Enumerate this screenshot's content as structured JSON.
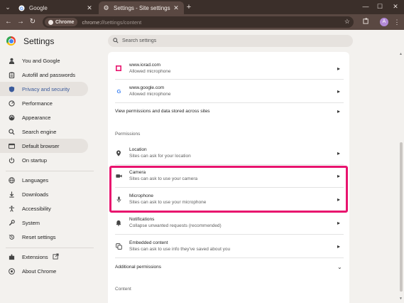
{
  "browser": {
    "tabs": [
      {
        "title": "Google",
        "active": false
      },
      {
        "title": "Settings - Site settings",
        "active": true
      }
    ],
    "new_tab_label": "+",
    "chip_label": "Chrome",
    "url_host": "chrome://",
    "url_path": "settings/content",
    "avatar_letter": "A"
  },
  "header": {
    "title": "Settings",
    "search_placeholder": "Search settings"
  },
  "sidebar": {
    "items": [
      {
        "label": "You and Google",
        "icon": "person-icon"
      },
      {
        "label": "Autofill and passwords",
        "icon": "clipboard-icon"
      },
      {
        "label": "Privacy and security",
        "icon": "shield-icon"
      },
      {
        "label": "Performance",
        "icon": "speedometer-icon"
      },
      {
        "label": "Appearance",
        "icon": "palette-icon"
      },
      {
        "label": "Search engine",
        "icon": "search-icon"
      },
      {
        "label": "Default browser",
        "icon": "browser-icon"
      },
      {
        "label": "On startup",
        "icon": "power-icon"
      },
      {
        "label": "Languages",
        "icon": "globe-icon"
      },
      {
        "label": "Downloads",
        "icon": "download-icon"
      },
      {
        "label": "Accessibility",
        "icon": "accessibility-icon"
      },
      {
        "label": "System",
        "icon": "wrench-icon"
      },
      {
        "label": "Reset settings",
        "icon": "reset-icon"
      },
      {
        "label": "Extensions",
        "icon": "puzzle-icon"
      },
      {
        "label": "About Chrome",
        "icon": "chrome-icon"
      }
    ]
  },
  "main": {
    "sites": [
      {
        "title": "www.iorad.com",
        "subtitle": "Allowed microphone"
      },
      {
        "title": "www.google.com",
        "subtitle": "Allowed microphone"
      }
    ],
    "view_all": "View permissions and data stored across sites",
    "permissions_heading": "Permissions",
    "permissions": [
      {
        "title": "Location",
        "subtitle": "Sites can ask for your location"
      },
      {
        "title": "Camera",
        "subtitle": "Sites can ask to use your camera"
      },
      {
        "title": "Microphone",
        "subtitle": "Sites can ask to use your microphone"
      },
      {
        "title": "Notifications",
        "subtitle": "Collapse unwanted requests (recommended)"
      },
      {
        "title": "Embedded content",
        "subtitle": "Sites can ask to use info they've saved about you"
      }
    ],
    "additional_permissions": "Additional permissions",
    "content_heading": "Content"
  },
  "colors": {
    "highlight": "#e8146e",
    "accent": "#3a5a9b"
  }
}
